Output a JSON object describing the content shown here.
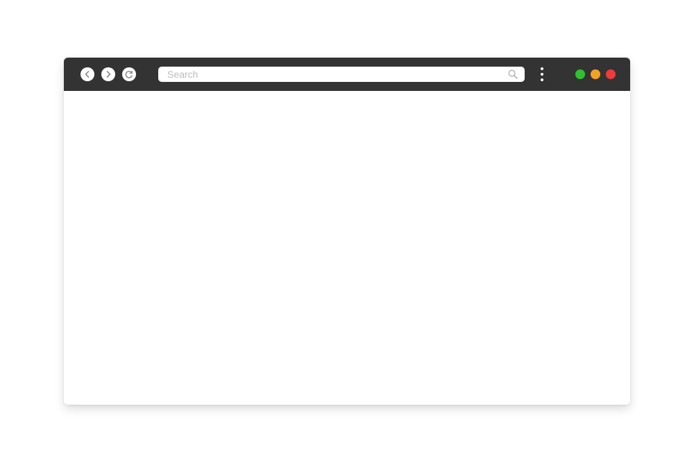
{
  "toolbar": {
    "search": {
      "placeholder": "Search",
      "value": "",
      "icon": "magnifier-icon"
    },
    "nav": {
      "back_icon": "chevron-left-icon",
      "forward_icon": "chevron-right-icon",
      "reload_icon": "reload-icon"
    },
    "menu_icon": "vertical-ellipsis-icon"
  },
  "window_controls": [
    {
      "name": "green",
      "color": "#2fc12f"
    },
    {
      "name": "orange",
      "color": "#f4a223"
    },
    {
      "name": "red",
      "color": "#ee3b3b"
    }
  ],
  "colors": {
    "toolbar_bg": "#333333",
    "window_bg": "#ffffff",
    "placeholder": "#bcbcbc",
    "nav_icon": "#8a8a8a"
  }
}
